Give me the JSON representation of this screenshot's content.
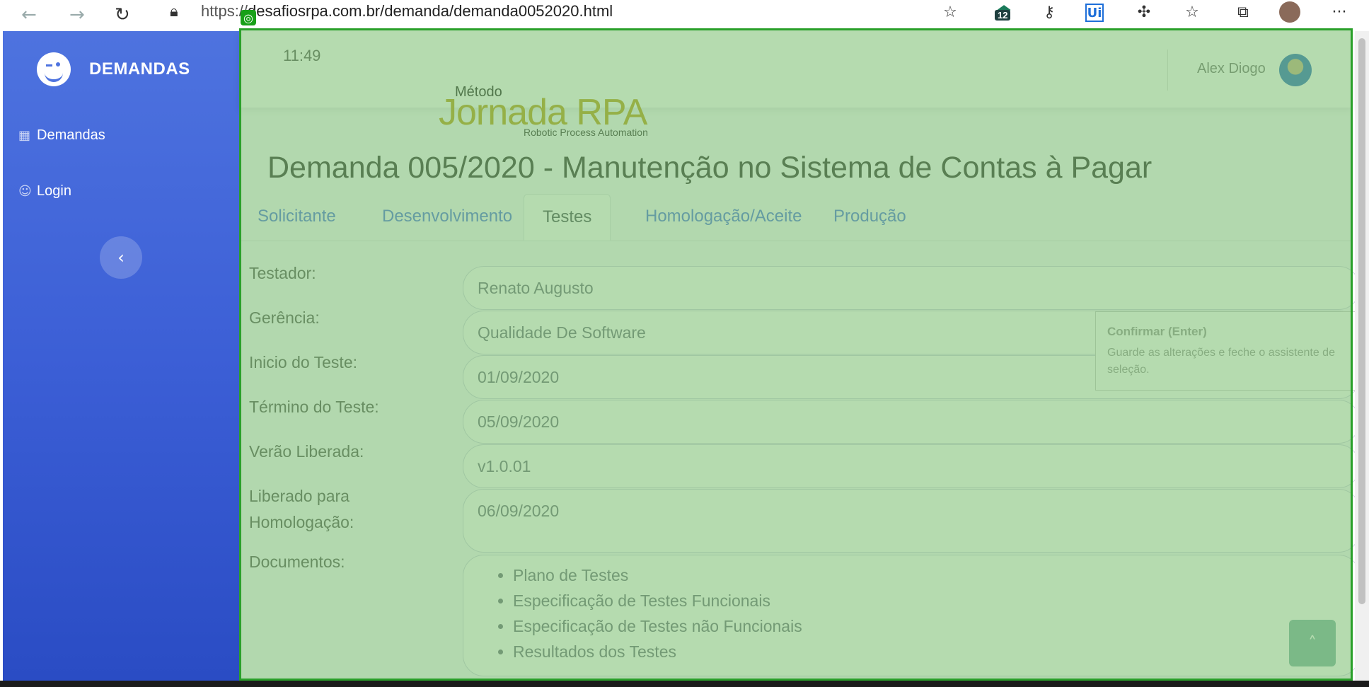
{
  "browser": {
    "url_prefix": "https://",
    "url_host": "desafiosrpa.com.br/demanda/demanda0052020.html",
    "extension_badge": "12",
    "more_label": "···"
  },
  "sidebar": {
    "brand": "DEMANDAS",
    "items": [
      {
        "label": "Demandas",
        "icon": "table-icon"
      },
      {
        "label": "Login",
        "icon": "user-circle-icon"
      }
    ],
    "toggle_icon": "‹"
  },
  "topbar": {
    "time": "11:49",
    "user_name": "Alex Diogo"
  },
  "logo": {
    "metodo": "Método",
    "name": "Jornada RPA",
    "subtitle": "Robotic Process Automation"
  },
  "page": {
    "title": "Demanda 005/2020 - Manutenção no Sistema de Contas à Pagar"
  },
  "tabs": [
    {
      "label": "Solicitante"
    },
    {
      "label": "Desenvolvimento"
    },
    {
      "label": "Testes"
    },
    {
      "label": "Homologação/Aceite"
    },
    {
      "label": "Produção"
    }
  ],
  "form": {
    "testador_label": "Testador:",
    "testador_value": "Renato Augusto",
    "gerencia_label": "Gerência:",
    "gerencia_value": "Qualidade De Software",
    "inicio_label": "Inicio do Teste:",
    "inicio_value": "01/09/2020",
    "termino_label": "Término do Teste:",
    "termino_value": "05/09/2020",
    "versao_label": "Verão Liberada:",
    "versao_value": "v1.0.01",
    "liberado_label_1": "Liberado para",
    "liberado_label_2": "Homologação:",
    "liberado_value": "06/09/2020",
    "documentos_label": "Documentos:",
    "documentos": [
      "Plano de Testes",
      "Especificação de Testes Funcionais",
      "Especificação de Testes não Funcionais",
      "Resultados dos Testes"
    ]
  },
  "tooltip": {
    "title": "Confirmar (Enter)",
    "text": "Guarde as alterações e feche o assistente de seleção."
  },
  "colors": {
    "sidebar": "#4e73df",
    "overlay": "#78be6e",
    "overlay_border": "#2aa02a"
  }
}
